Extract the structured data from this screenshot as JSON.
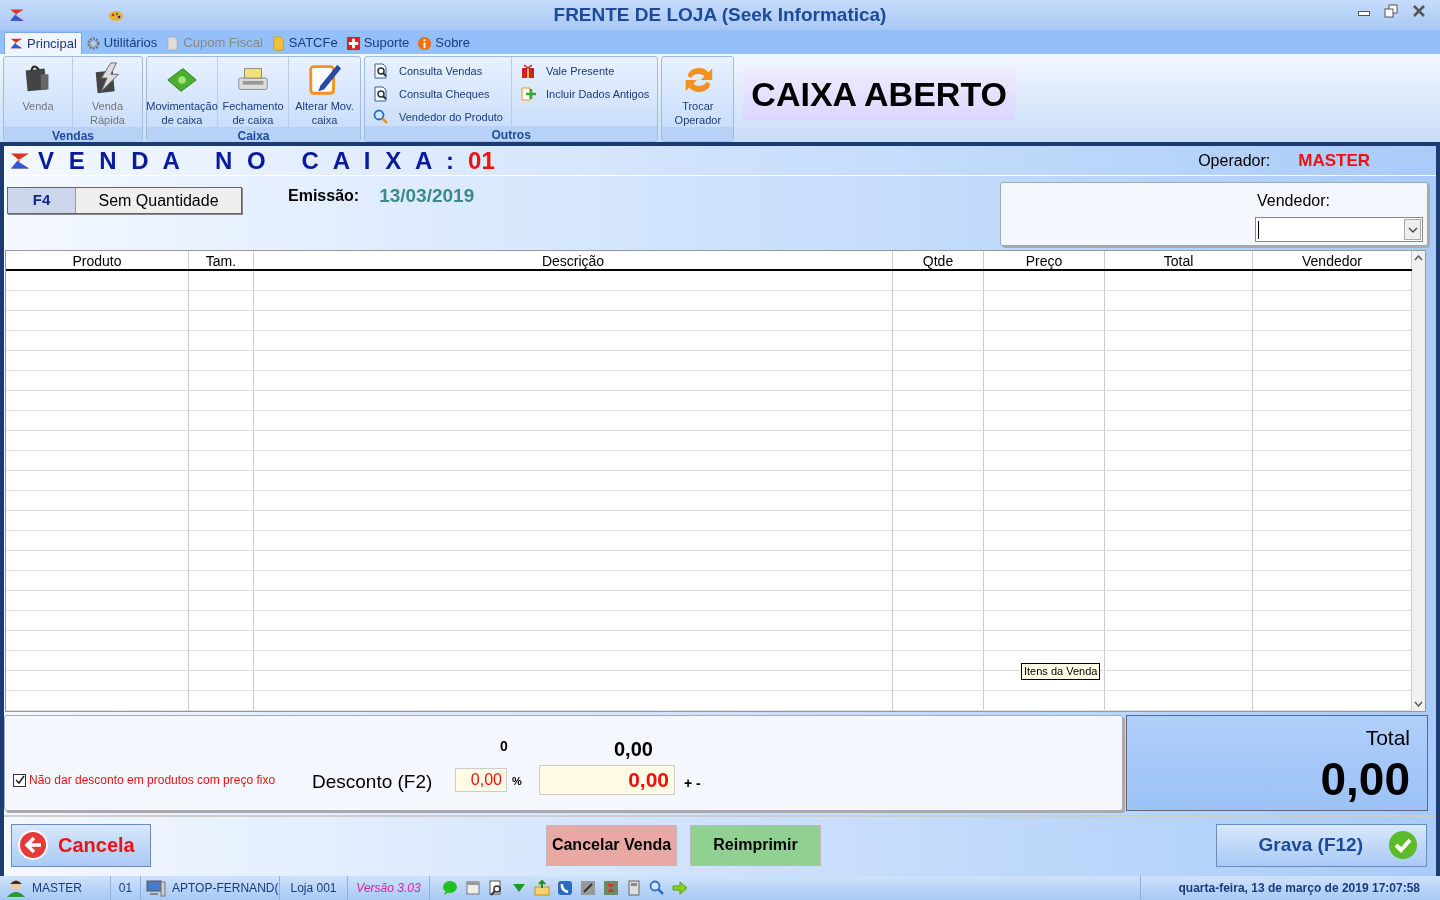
{
  "window": {
    "title": "FRENTE DE LOJA (Seek Informatica)"
  },
  "menu_tabs": [
    {
      "label": "Principal",
      "selected": true
    },
    {
      "label": "Utilitários",
      "selected": false
    },
    {
      "label": "Cupom Fiscal",
      "selected": false
    },
    {
      "label": "SATCFe",
      "selected": false
    },
    {
      "label": "Suporte",
      "selected": false
    },
    {
      "label": "Sobre",
      "selected": false
    }
  ],
  "ribbon_groups": [
    {
      "label": "Vendas",
      "kind": "large",
      "items": [
        {
          "label": "Venda",
          "disabled": true
        },
        {
          "label": "Venda Rápida",
          "disabled": true
        }
      ]
    },
    {
      "label": "Caixa",
      "kind": "large",
      "items": [
        {
          "label": "Movimentação de caixa",
          "disabled": false
        },
        {
          "label": "Fechamento de caixa",
          "disabled": false
        },
        {
          "label": "Alterar Mov. caixa",
          "disabled": false
        }
      ]
    },
    {
      "label": "Outros",
      "kind": "small",
      "items": [
        {
          "label": "Consulta Vendas"
        },
        {
          "label": "Consulta Cheques"
        },
        {
          "label": "Vendedor do Produto"
        },
        {
          "label": "Vale Presente"
        },
        {
          "label": "Incluir Dados Antigos"
        }
      ]
    },
    {
      "kind": "large",
      "items": [
        {
          "label": "Trocar Operador",
          "disabled": false
        }
      ]
    }
  ],
  "status_banner": "CAIXA ABERTO",
  "sale_header": {
    "title": "V E N D A   N O   C A I X A :",
    "register": "01",
    "operator_label": "Operador:",
    "operator": "MASTER"
  },
  "quantity_mode": {
    "key": "F4",
    "label": "Sem Quantidade"
  },
  "issue": {
    "label": "Emissão:",
    "date": "13/03/2019"
  },
  "seller": {
    "label": "Vendedor:"
  },
  "table": {
    "columns": [
      "Produto",
      "Tam.",
      "Descrição",
      "Qtde",
      "Preço",
      "Total",
      "Vendedor"
    ]
  },
  "tooltip": "Itens da Venda",
  "summary": {
    "count": "0",
    "subtotal": "0,00",
    "no_discount_fixed": {
      "label": "Não dar desconto em produtos com preço fixo",
      "checked": true
    },
    "discount_label": "Desconto (F2)",
    "discount_percent": "0,00",
    "percent_sign": "%",
    "discount_value": "0,00",
    "plus_minus": "+ -",
    "total_label": "Total",
    "total": "0,00"
  },
  "buttons": [
    {
      "label": "Cancela",
      "kind": "cancel"
    },
    {
      "label": "Cancelar Venda",
      "kind": "red"
    },
    {
      "label": "Reimprimir",
      "kind": "green"
    },
    {
      "label": "Grava (F12)",
      "kind": "save"
    }
  ],
  "status_bar": {
    "user": "MASTER",
    "register": "01",
    "computer": "APTOP-FERNAND(",
    "store": "Loja 001",
    "version": "Versão 3.03",
    "datetime": "quarta-feira, 13 de março de 2019 17:07:58"
  }
}
